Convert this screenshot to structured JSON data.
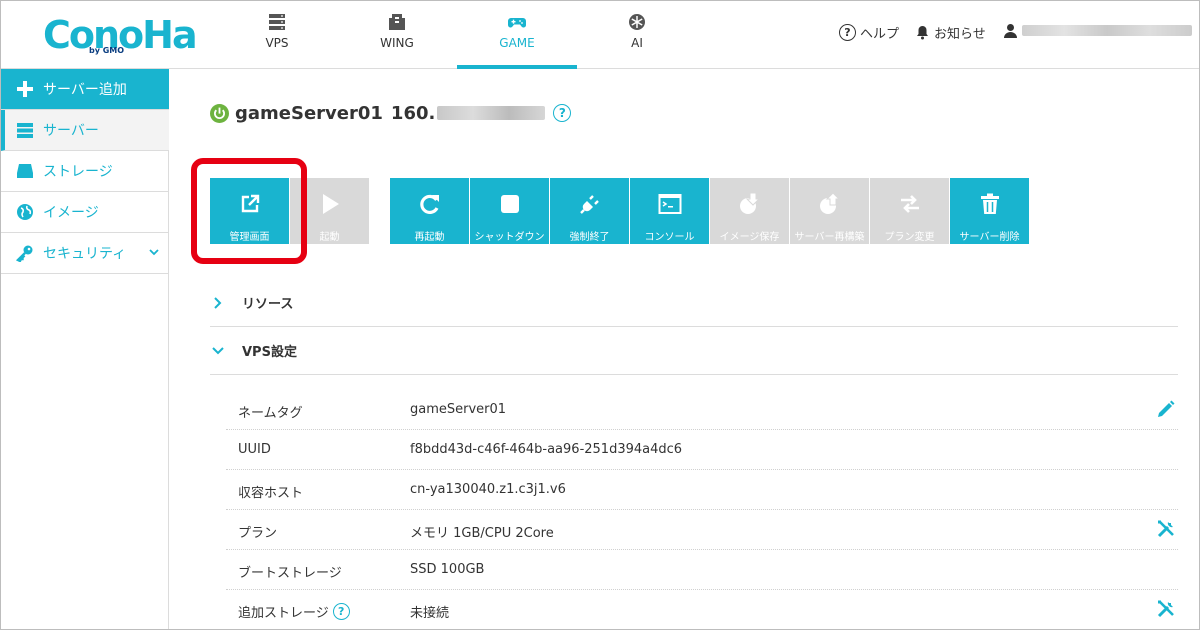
{
  "brand": {
    "logo_text": "ConoHa",
    "logo_sub": "by GMO",
    "accent": "#19b4cf",
    "highlight": "#e60012"
  },
  "nav": [
    {
      "label": "VPS",
      "icon": "server-stack-icon"
    },
    {
      "label": "WING",
      "icon": "wing-building-icon"
    },
    {
      "label": "GAME",
      "icon": "gamepad-icon",
      "active": true
    },
    {
      "label": "AI",
      "icon": "ai-snowflake-icon"
    }
  ],
  "header_right": {
    "help": "ヘルプ",
    "notifications": "お知らせ"
  },
  "sidebar": [
    {
      "label": "サーバー追加",
      "icon": "plus-icon"
    },
    {
      "label": "サーバー",
      "icon": "server-icon",
      "selected": true
    },
    {
      "label": "ストレージ",
      "icon": "storage-icon"
    },
    {
      "label": "イメージ",
      "icon": "globe-icon"
    },
    {
      "label": "セキュリティ",
      "icon": "key-icon"
    }
  ],
  "server": {
    "name": "gameServer01",
    "ip_prefix": "160.",
    "status_color": "#6db33f"
  },
  "toolbar": [
    {
      "label": "管理画面",
      "icon": "external-link-icon",
      "enabled": true
    },
    {
      "label": "起動",
      "icon": "play-icon",
      "enabled": false
    },
    {
      "label": "再起動",
      "icon": "restart-icon",
      "enabled": true
    },
    {
      "label": "シャットダウン",
      "icon": "stop-icon",
      "enabled": true
    },
    {
      "label": "強制終了",
      "icon": "plug-icon",
      "enabled": true
    },
    {
      "label": "コンソール",
      "icon": "console-icon",
      "enabled": true
    },
    {
      "label": "イメージ保存",
      "icon": "image-save-icon",
      "enabled": false
    },
    {
      "label": "サーバー再構築",
      "icon": "rebuild-icon",
      "enabled": false
    },
    {
      "label": "プラン変更",
      "icon": "swap-icon",
      "enabled": false
    },
    {
      "label": "サーバー削除",
      "icon": "trash-icon",
      "enabled": true
    }
  ],
  "sections": {
    "resources": "リソース",
    "vps_settings": "VPS設定"
  },
  "settings_rows": [
    {
      "label": "ネームタグ",
      "value": "gameServer01",
      "action": "pencil-icon"
    },
    {
      "label": "UUID",
      "value": "f8bdd43d-c46f-464b-aa96-251d394a4dc6"
    },
    {
      "label": "収容ホスト",
      "value": "cn-ya130040.z1.c3j1.v6"
    },
    {
      "label": "プラン",
      "value": "メモリ 1GB/CPU 2Core",
      "action": "wrench-icon"
    },
    {
      "label": "ブートストレージ",
      "value": "SSD 100GB"
    },
    {
      "label": "追加ストレージ",
      "value": "未接続",
      "action": "wrench-icon",
      "help": true
    }
  ]
}
